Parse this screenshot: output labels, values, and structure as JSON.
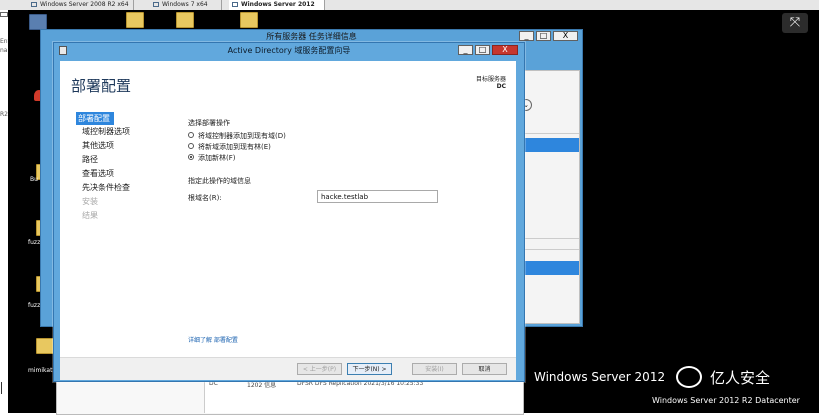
{
  "vm_tabs": [
    {
      "label": "Windows Server 2008 R2 x64",
      "active": false
    },
    {
      "label": "Windows 7 x64",
      "active": false
    },
    {
      "label": "Windows Server 2012",
      "active": true
    }
  ],
  "desktop": {
    "left_labels": [
      "Ent",
      "nal",
      "R2"
    ],
    "icon_labels": [
      "Bu",
      "fuzz",
      "fuzz",
      "mimikat"
    ],
    "brand": "Windows Server 2012",
    "edition": "Windows Server 2012 R2 Datacenter",
    "watermark": "亿人安全"
  },
  "back_window": {
    "title": "所有服务器 任务详细信息",
    "bottom_row": [
      "DC",
      "1202 信息",
      "DFSR DFS Replication 2021/3/16 10:25:33"
    ]
  },
  "wizard": {
    "title": "Active Directory 域服务配置向导",
    "page_heading": "部署配置",
    "target_label": "目标服务器",
    "target_value": "DC",
    "nav": [
      {
        "label": "部署配置",
        "state": "active"
      },
      {
        "label": "域控制器选项",
        "state": "normal"
      },
      {
        "label": "其他选项",
        "state": "normal"
      },
      {
        "label": "路径",
        "state": "normal"
      },
      {
        "label": "查看选项",
        "state": "normal"
      },
      {
        "label": "先决条件检查",
        "state": "normal"
      },
      {
        "label": "安装",
        "state": "disabled"
      },
      {
        "label": "结果",
        "state": "disabled"
      }
    ],
    "operation_label": "选择部署操作",
    "options": [
      {
        "label": "将域控制器添加到现有域(D)",
        "selected": false
      },
      {
        "label": "将新域添加到现有林(E)",
        "selected": false
      },
      {
        "label": "添加新林(F)",
        "selected": true
      }
    ],
    "domain_info_label": "指定此操作的域信息",
    "root_domain_label": "根域名(R):",
    "root_domain_value": "hacke.testlab",
    "more_link": "详细了解 部署配置",
    "buttons": {
      "prev": "< 上一步(P)",
      "next": "下一步(N) >",
      "install": "安装(I)",
      "cancel": "取消"
    }
  }
}
